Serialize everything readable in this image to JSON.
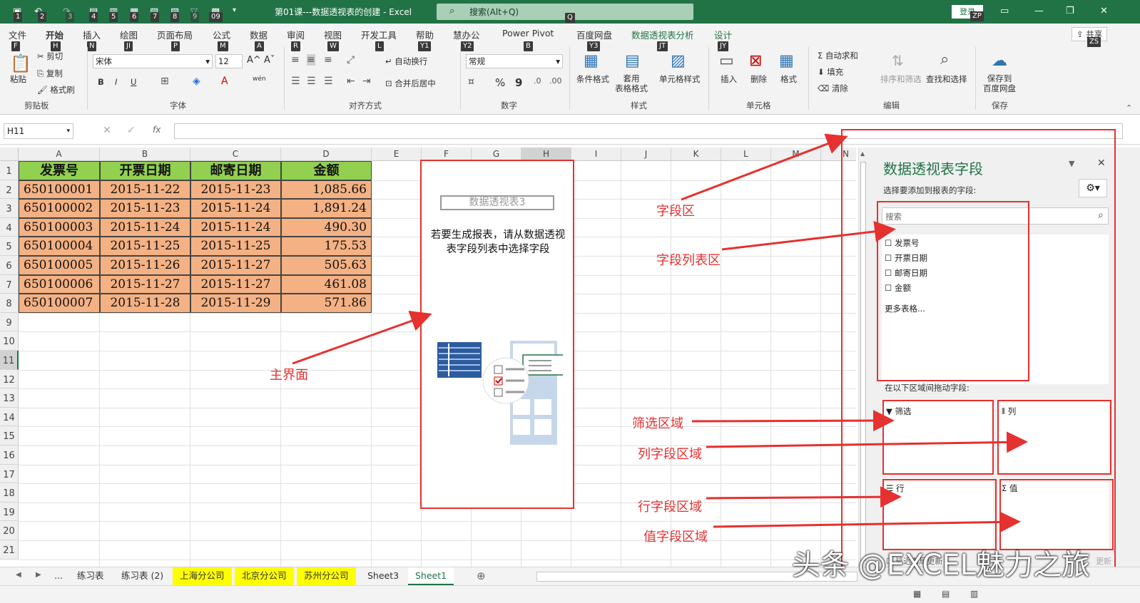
{
  "app": {
    "title": "第01课---数据透视表的创建  -  Excel",
    "search_placeholder": "搜索(Alt+Q)",
    "login": "登录",
    "login_key": "ZP",
    "search_key": "Q"
  },
  "qat_keys": [
    "1",
    "2",
    "3",
    "4",
    "5",
    "6",
    "7",
    "8",
    "9",
    "09"
  ],
  "tabs": [
    {
      "label": "文件",
      "key": "F"
    },
    {
      "label": "开始",
      "key": "H"
    },
    {
      "label": "插入",
      "key": "N"
    },
    {
      "label": "绘图",
      "key": "JI"
    },
    {
      "label": "页面布局",
      "key": "P"
    },
    {
      "label": "公式",
      "key": "M"
    },
    {
      "label": "数据",
      "key": "A"
    },
    {
      "label": "审阅",
      "key": "R"
    },
    {
      "label": "视图",
      "key": "W"
    },
    {
      "label": "开发工具",
      "key": "L"
    },
    {
      "label": "帮助",
      "key": "Y1"
    },
    {
      "label": "慧办公",
      "key": "Y2"
    },
    {
      "label": "Power Pivot",
      "key": "B"
    },
    {
      "label": "百度网盘",
      "key": "Y3"
    },
    {
      "label": "数据透视表分析",
      "key": "JT"
    },
    {
      "label": "设计",
      "key": "JY"
    }
  ],
  "share": {
    "label": "共享",
    "key": "ZS"
  },
  "ribbon": {
    "clipboard": {
      "paste": "粘贴",
      "cut": "剪切",
      "copy": "复制",
      "painter": "格式刷",
      "group": "剪贴板"
    },
    "font": {
      "name": "宋体",
      "size": "12",
      "group": "字体",
      "bold": "B",
      "italic": "I",
      "underline": "U",
      "grow": "A^",
      "shrink": "Aˇ",
      "wen": "wén"
    },
    "align": {
      "wrap": "自动换行",
      "merge": "合并后居中",
      "group": "对齐方式"
    },
    "number": {
      "format": "常规",
      "group": "数字",
      "percent": "%",
      "comma": "9"
    },
    "styles": {
      "cond": "条件格式",
      "table": "套用\n表格格式",
      "cell": "单元格样式",
      "group": "样式"
    },
    "cells": {
      "insert": "插入",
      "delete": "删除",
      "format": "格式",
      "group": "单元格"
    },
    "editing": {
      "autosum": "自动求和",
      "fill": "填充",
      "clear": "清除",
      "sort": "排序和筛选",
      "find": "查找和选择",
      "group": "编辑"
    },
    "save": {
      "label": "保存到\n百度网盘",
      "group": "保存"
    }
  },
  "formula": {
    "namebox": "H11",
    "value": "",
    "fx": "fx"
  },
  "columns": [
    "A",
    "B",
    "C",
    "D",
    "E",
    "F",
    "G",
    "H",
    "I",
    "J",
    "K",
    "L",
    "M",
    "N"
  ],
  "rows": [
    "1",
    "2",
    "3",
    "4",
    "5",
    "6",
    "7",
    "8",
    "9",
    "10",
    "11",
    "12",
    "13",
    "14",
    "15",
    "16",
    "17",
    "18",
    "19",
    "20",
    "21"
  ],
  "table": {
    "headers": [
      "发票号",
      "开票日期",
      "邮寄日期",
      "金额"
    ],
    "rows": [
      [
        "650100001",
        "2015-11-22",
        "2015-11-23",
        "1,085.66"
      ],
      [
        "650100002",
        "2015-11-23",
        "2015-11-24",
        "1,891.24"
      ],
      [
        "650100003",
        "2015-11-24",
        "2015-11-24",
        "490.30"
      ],
      [
        "650100004",
        "2015-11-25",
        "2015-11-25",
        "175.53"
      ],
      [
        "650100005",
        "2015-11-26",
        "2015-11-27",
        "505.63"
      ],
      [
        "650100006",
        "2015-11-27",
        "2015-11-27",
        "461.08"
      ],
      [
        "650100007",
        "2015-11-28",
        "2015-11-29",
        "571.86"
      ]
    ]
  },
  "pivot": {
    "name": "数据透视表3",
    "hint": "若要生成报表，请从数据透视\n表字段列表中选择字段"
  },
  "pane": {
    "title": "数据透视表字段",
    "subtitle": "选择要添加到报表的字段:",
    "search": "搜索",
    "fields": [
      "发票号",
      "开票日期",
      "邮寄日期",
      "金额"
    ],
    "more": "更多表格...",
    "drag_hint": "在以下区域间拖动字段:",
    "areas": {
      "filter": "筛选",
      "columns": "列",
      "rows": "行",
      "values": "值"
    },
    "defer": "延迟布局更新",
    "update": "更新"
  },
  "annotations": {
    "field_area": "字段区",
    "field_list": "字段列表区",
    "main": "主界面",
    "filter": "筛选区域",
    "col": "列字段区域",
    "row": "行字段区域",
    "val": "值字段区域"
  },
  "sheets": [
    "...",
    "练习表",
    "练习表 (2)",
    "上海分公司",
    "北京分公司",
    "苏州分公司",
    "Sheet3",
    "Sheet1"
  ],
  "watermark": "头条 @EXCEL魅力之旅"
}
